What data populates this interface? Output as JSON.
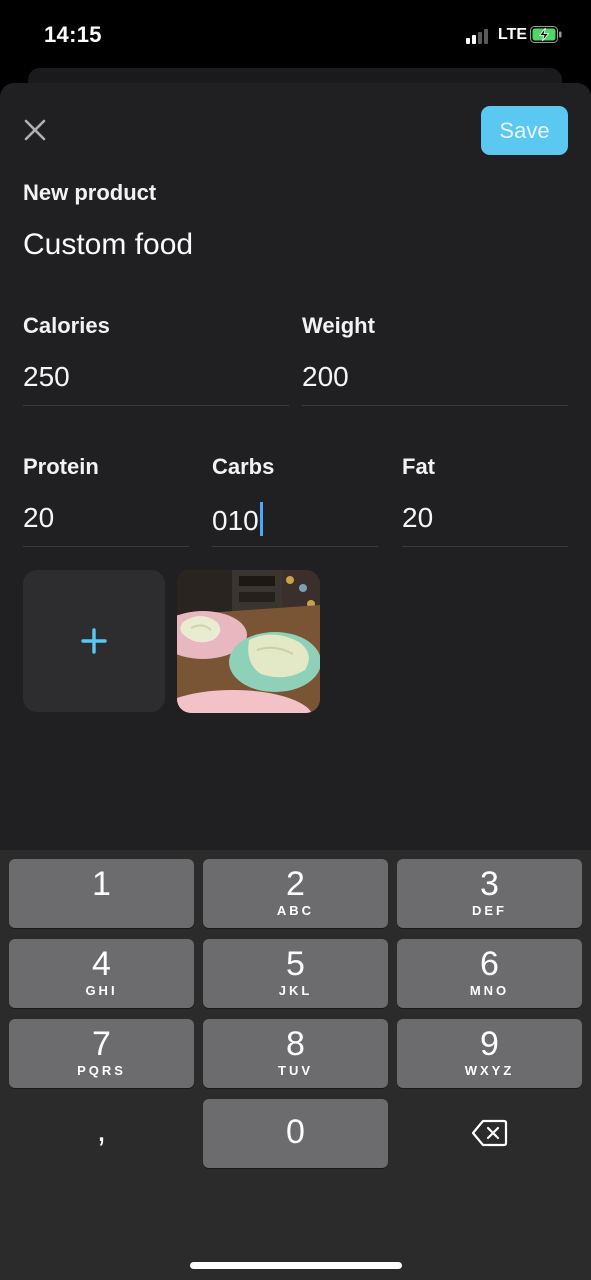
{
  "status_bar": {
    "time": "14:15",
    "network": "LTE"
  },
  "header": {
    "save_label": "Save"
  },
  "form": {
    "section_label": "New product",
    "name_value": "Custom food",
    "calories": {
      "label": "Calories",
      "value": "250"
    },
    "weight": {
      "label": "Weight",
      "value": "200"
    },
    "protein": {
      "label": "Protein",
      "value": "20"
    },
    "carbs": {
      "label": "Carbs",
      "value": "010"
    },
    "fat": {
      "label": "Fat",
      "value": "20"
    }
  },
  "keyboard": {
    "keys": [
      {
        "num": "1",
        "letters": ""
      },
      {
        "num": "2",
        "letters": "ABC"
      },
      {
        "num": "3",
        "letters": "DEF"
      },
      {
        "num": "4",
        "letters": "GHI"
      },
      {
        "num": "5",
        "letters": "JKL"
      },
      {
        "num": "6",
        "letters": "MNO"
      },
      {
        "num": "7",
        "letters": "PQRS"
      },
      {
        "num": "8",
        "letters": "TUV"
      },
      {
        "num": "9",
        "letters": "WXYZ"
      },
      {
        "num": ",",
        "letters": ""
      },
      {
        "num": "0",
        "letters": ""
      }
    ]
  },
  "colors": {
    "accent": "#5ac8f0",
    "sheet_bg": "#202022",
    "key_bg": "#6c6c6e"
  },
  "icons": {
    "close": "close-icon",
    "add": "plus-icon",
    "delete": "backspace-icon"
  }
}
